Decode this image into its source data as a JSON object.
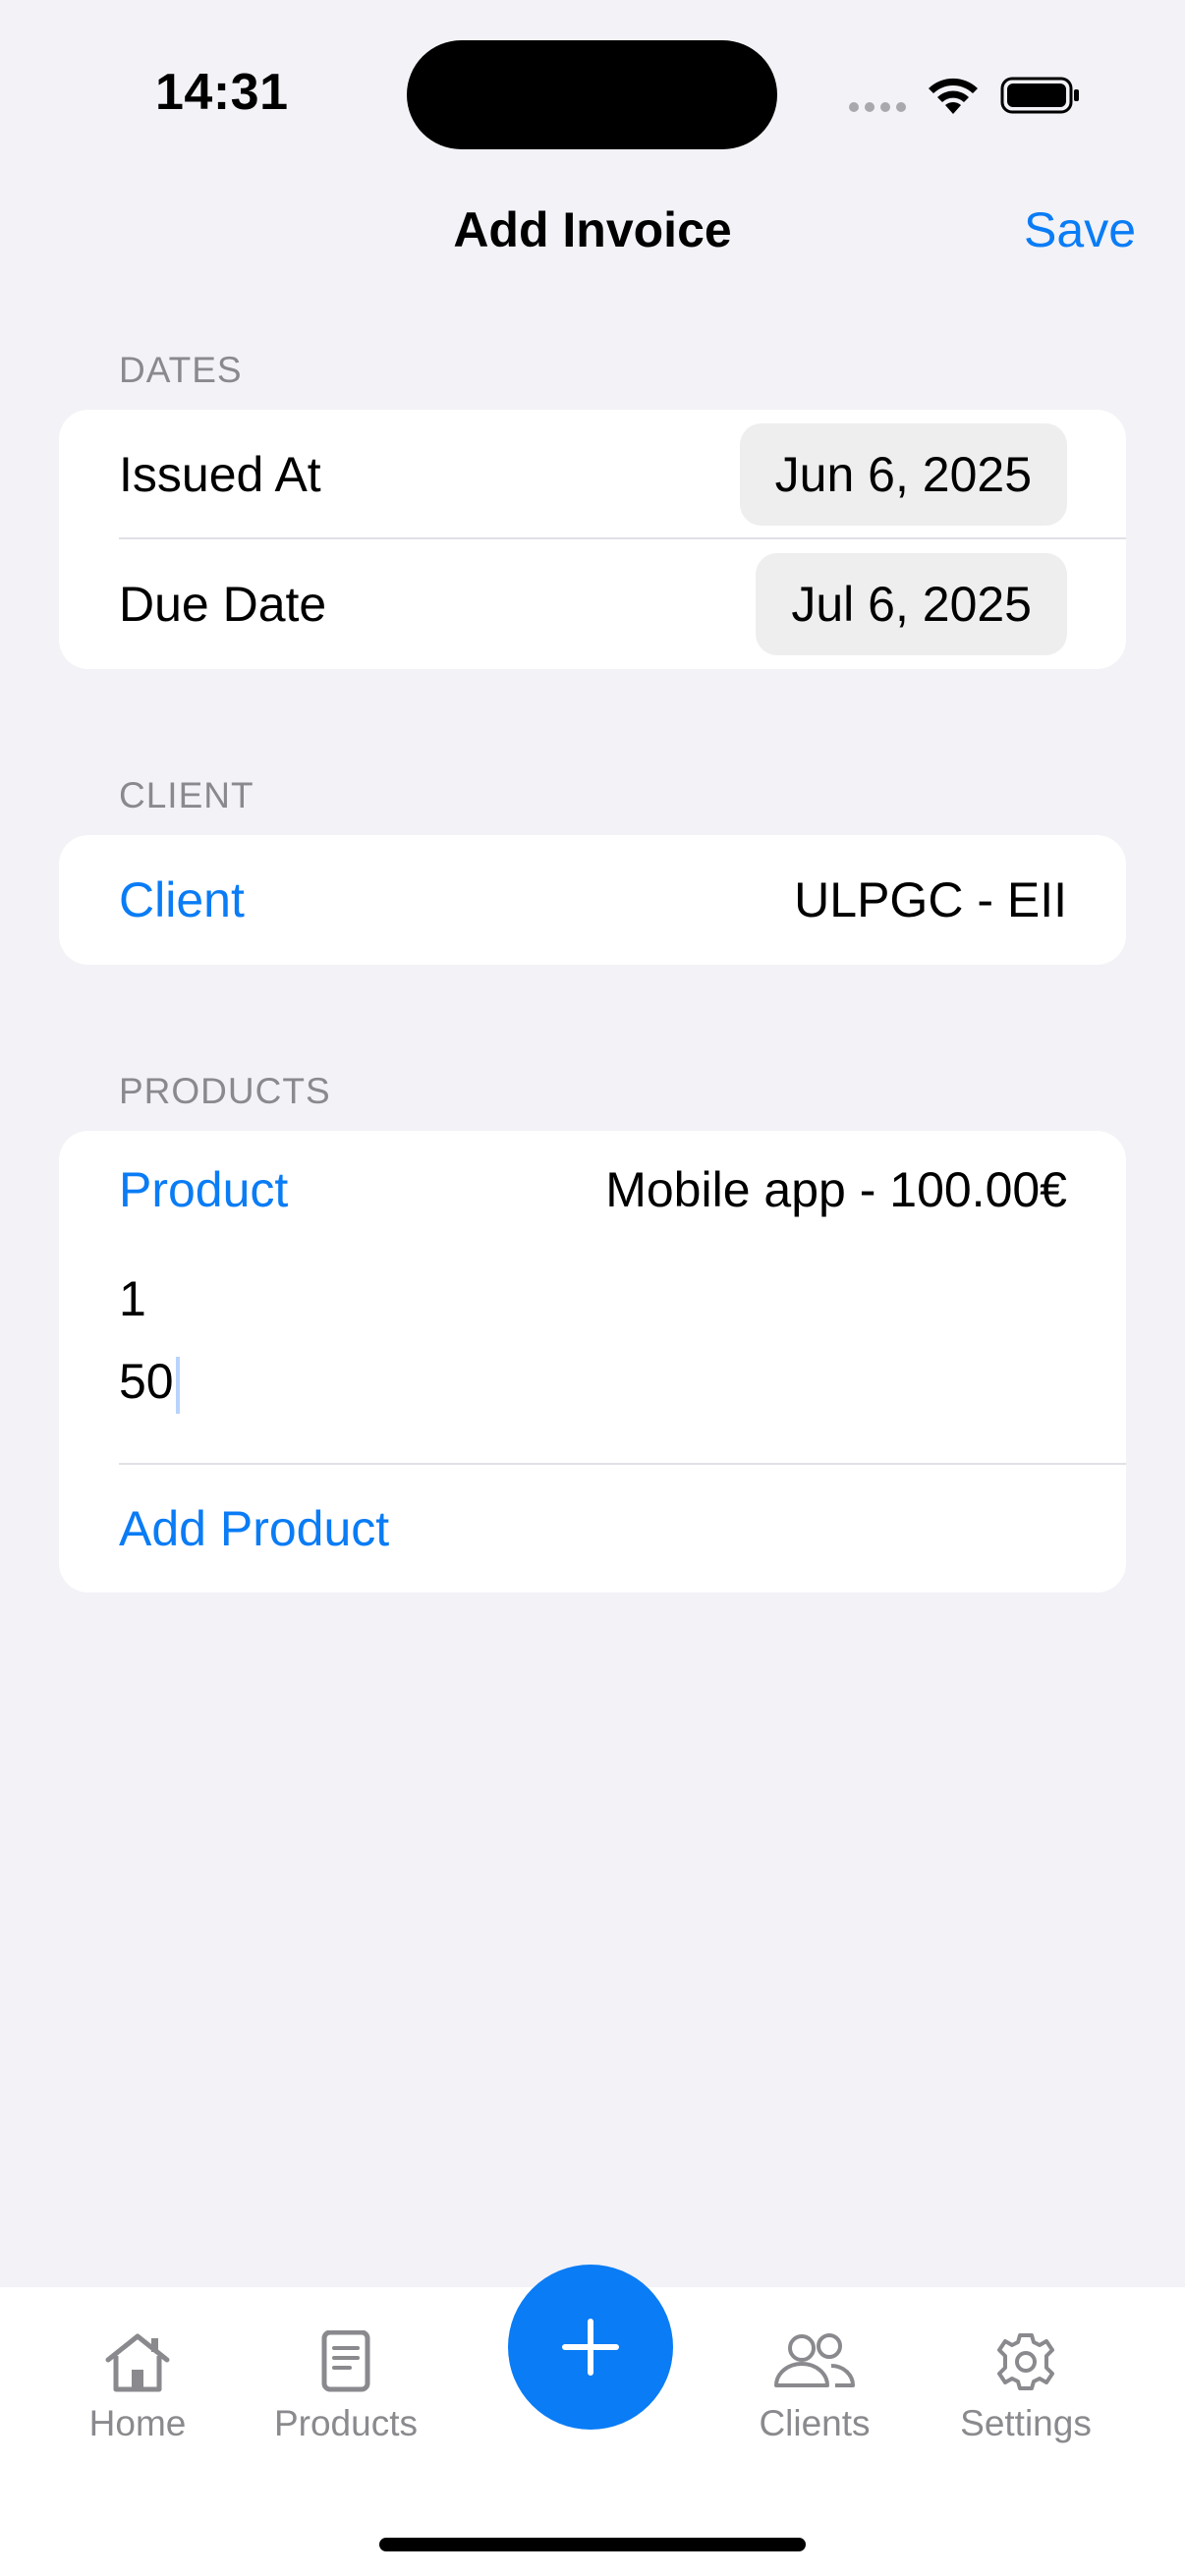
{
  "status_bar": {
    "time": "14:31"
  },
  "nav": {
    "title": "Add Invoice",
    "save_label": "Save"
  },
  "dates_section": {
    "header": "DATES",
    "issued_label": "Issued At",
    "issued_value": "Jun 6, 2025",
    "due_label": "Due Date",
    "due_value": "Jul 6, 2025"
  },
  "client_section": {
    "header": "CLIENT",
    "label": "Client",
    "value": "ULPGC - EII"
  },
  "products_section": {
    "header": "PRODUCTS",
    "product_label": "Product",
    "product_value": "Mobile app - 100.00€",
    "quantity_value": "1",
    "price_value": "50",
    "add_label": "Add Product"
  },
  "tab_bar": {
    "items": [
      {
        "label": "Home",
        "icon": "house-icon"
      },
      {
        "label": "Products",
        "icon": "document-icon"
      },
      {
        "label": "",
        "icon": "plus-icon"
      },
      {
        "label": "Clients",
        "icon": "people-icon"
      },
      {
        "label": "Settings",
        "icon": "gear-icon"
      }
    ]
  },
  "colors": {
    "accent": "#0a7cf5",
    "background": "#f2f2f7",
    "secondary_text": "#8a8a8e"
  }
}
